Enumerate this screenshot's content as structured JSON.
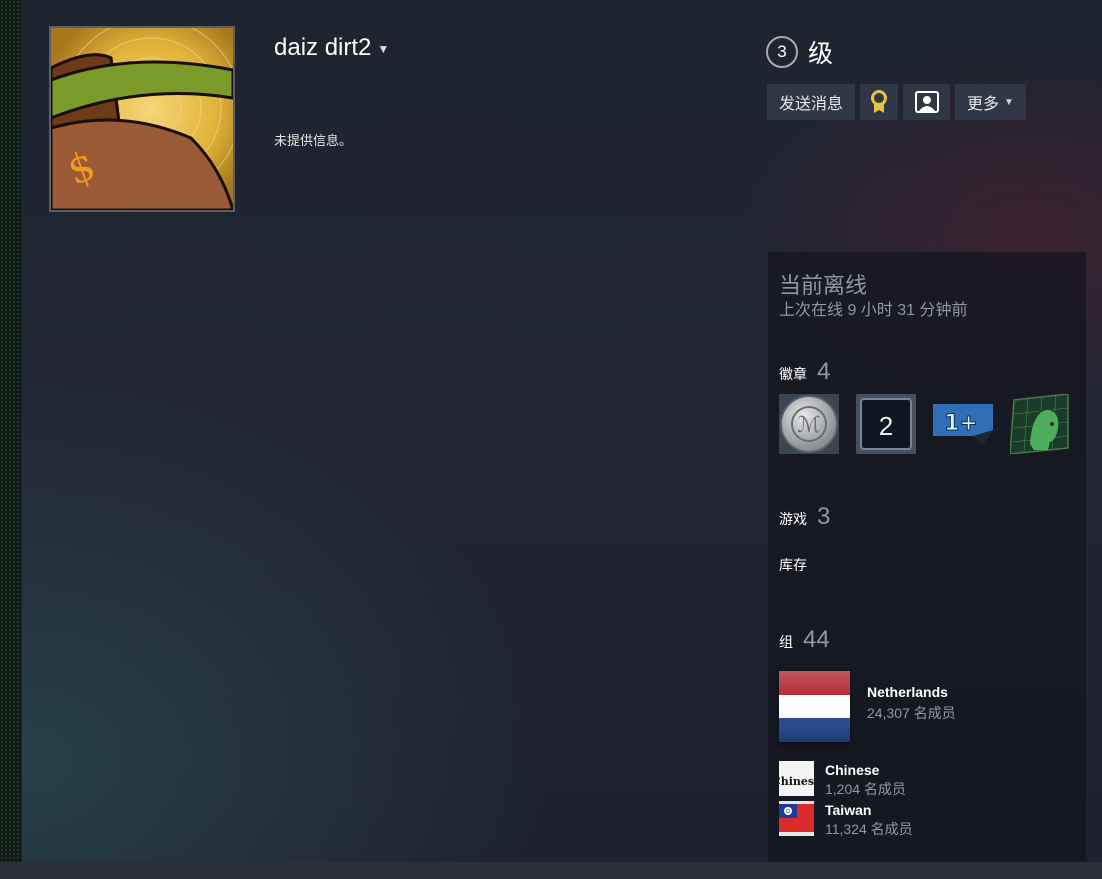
{
  "profile": {
    "persona_name": "daiz dirt2",
    "summary": "未提供信息。"
  },
  "level": {
    "number": "3",
    "label": "级"
  },
  "actions": {
    "send_message": "发送消息",
    "more": "更多"
  },
  "status": {
    "title": "当前离线",
    "last_online": "上次在线 9 小时 31 分钟前"
  },
  "badges": {
    "label": "徽章",
    "count": "4",
    "items": [
      "badge-coin-icon",
      "badge-years-icon",
      "badge-level-up-icon",
      "badge-portrait-icon"
    ],
    "years_badge_text": "2",
    "level_badge_text": "1+"
  },
  "games": {
    "label": "游戏",
    "count": "3"
  },
  "inventory": {
    "label": "库存"
  },
  "groups": {
    "label": "组",
    "count": "44",
    "items": [
      {
        "name": "Netherlands",
        "members": "24,307 名成员"
      },
      {
        "name": "Chinese",
        "members": "1,204 名成员",
        "logo_text": "Chinese"
      },
      {
        "name": "Taiwan",
        "members": "11,324 名成员"
      }
    ]
  },
  "colors": {
    "background": "#1b1f29",
    "panel": "#14151c",
    "button": "#2f3746",
    "muted_text": "#8f98a0",
    "gold": "#e8c33b"
  }
}
